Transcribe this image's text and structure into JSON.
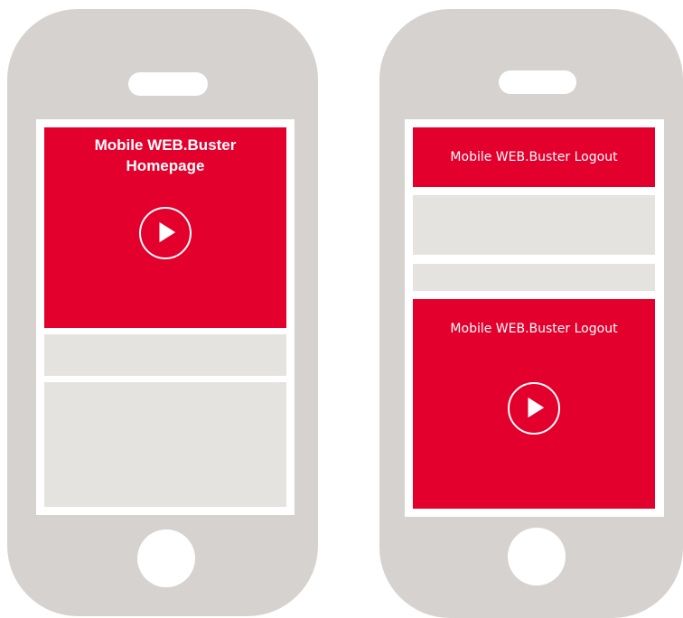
{
  "phone_left": {
    "hero_title_line1": "Mobile WEB.Buster",
    "hero_title_line2": "Homepage",
    "play_icon": "play-icon"
  },
  "phone_right": {
    "banner_title": "Mobile WEB.Buster Logout",
    "hero_title": "Mobile WEB.Buster Logout",
    "play_icon": "play-icon"
  },
  "colors": {
    "accent_red": "#e3002d",
    "device_gray": "#d6d2cf",
    "placeholder_gray": "#e5e3e0"
  }
}
